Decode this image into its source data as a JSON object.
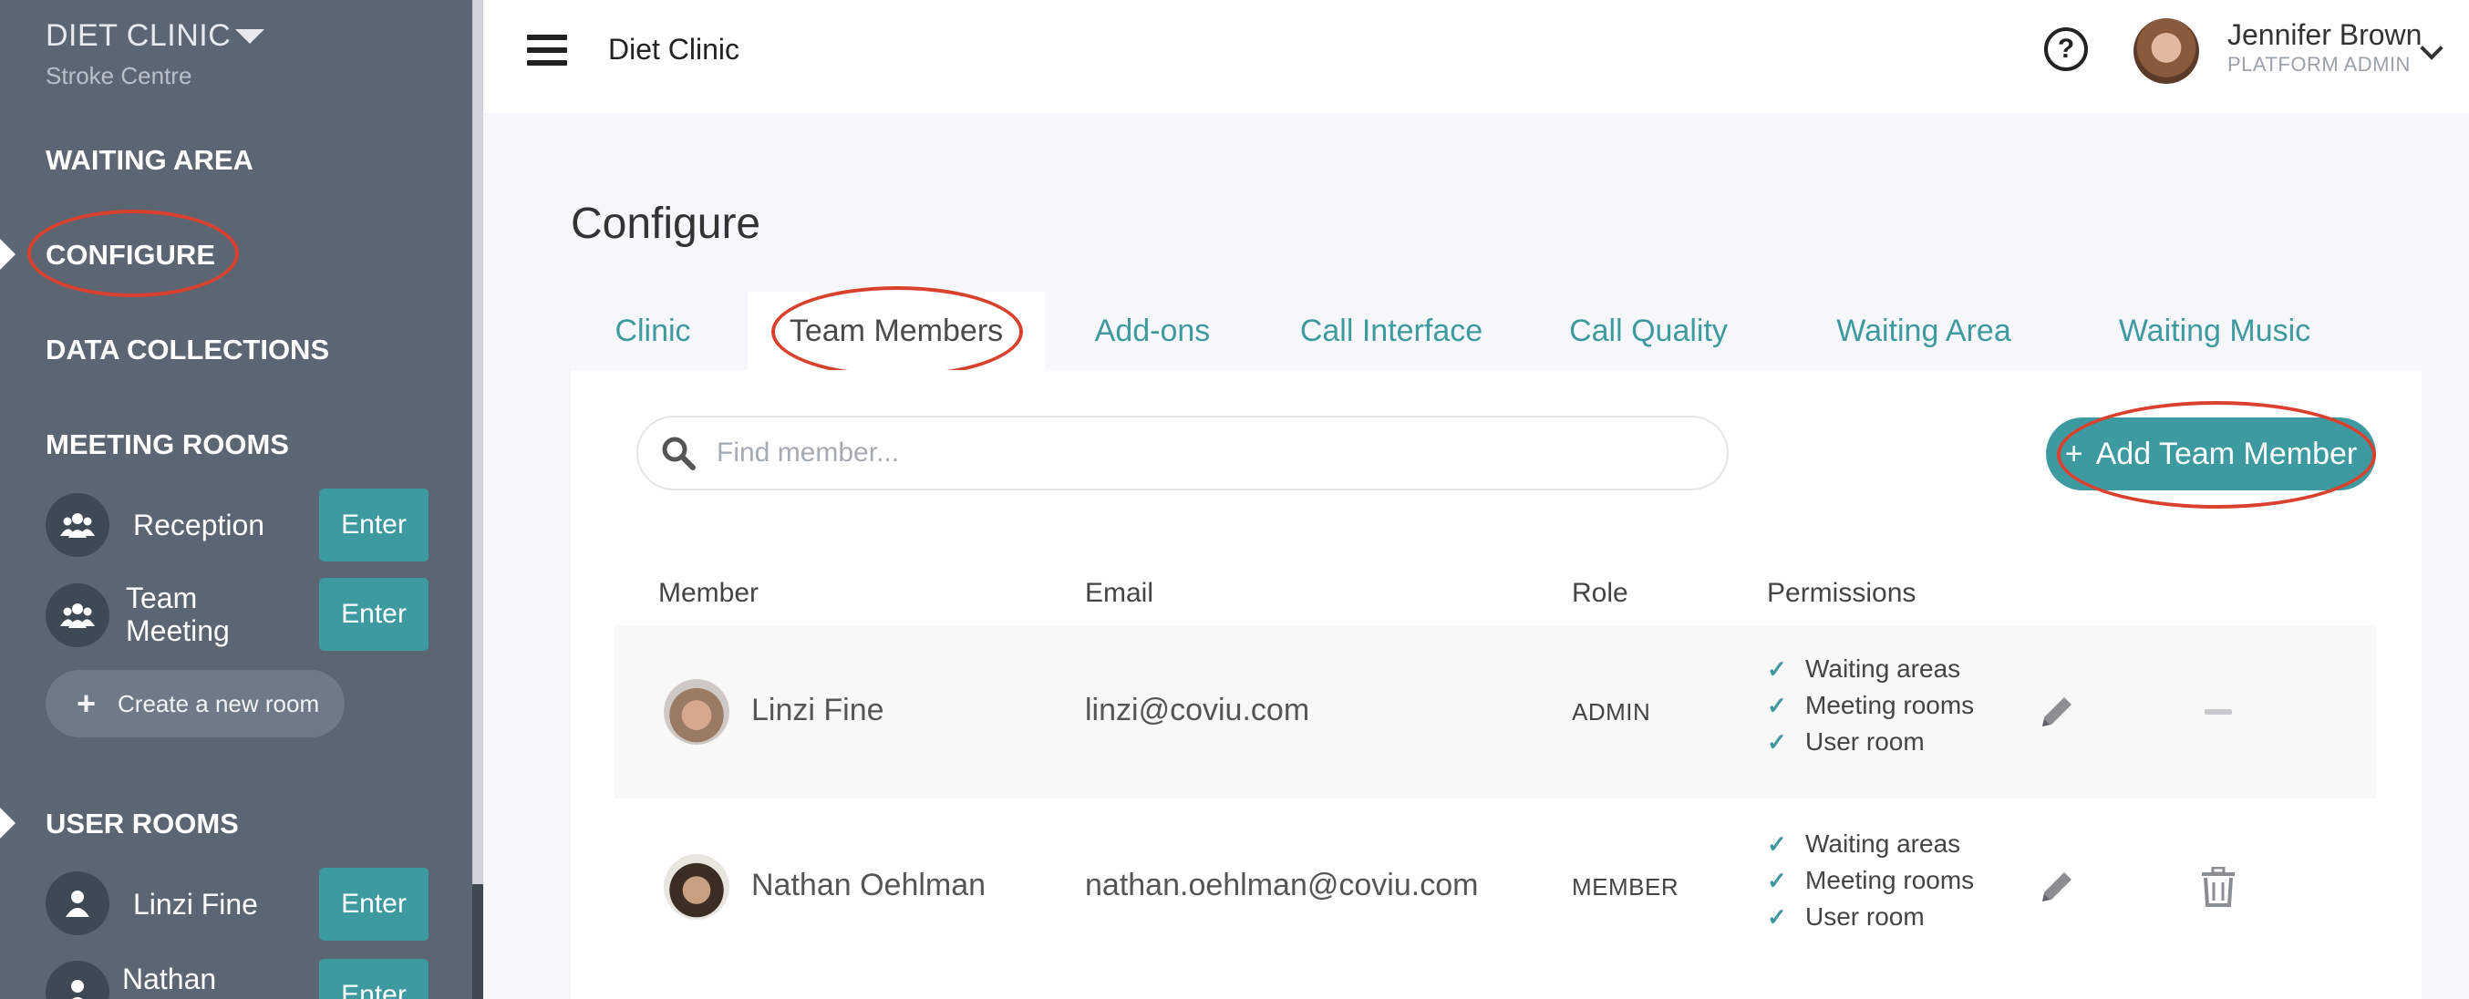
{
  "sidebar": {
    "clinic_name": "DIET CLINIC",
    "clinic_sub": "Stroke Centre",
    "nav": {
      "waiting_area": "WAITING AREA",
      "configure": "CONFIGURE",
      "data_collections": "DATA COLLECTIONS",
      "meeting_rooms": "MEETING ROOMS",
      "user_rooms": "USER ROOMS"
    },
    "meeting_rooms": [
      {
        "name": "Reception",
        "button": "Enter"
      },
      {
        "name": "Team Meeting",
        "button": "Enter"
      }
    ],
    "create_room": "Create a new room",
    "user_rooms": [
      {
        "name": "Linzi Fine",
        "button": "Enter"
      },
      {
        "name": "Nathan",
        "button": "Enter"
      }
    ]
  },
  "header": {
    "title": "Diet Clinic",
    "user_name": "Jennifer Brown",
    "user_role": "PLATFORM ADMIN"
  },
  "main": {
    "page_title": "Configure",
    "tabs": [
      "Clinic",
      "Team Members",
      "Add-ons",
      "Call Interface",
      "Call Quality",
      "Waiting Area",
      "Waiting Music"
    ],
    "active_tab": "Team Members",
    "search_placeholder": "Find member...",
    "add_button": "Add Team Member",
    "columns": [
      "Member",
      "Email",
      "Role",
      "Permissions"
    ],
    "members": [
      {
        "name": "Linzi Fine",
        "email": "linzi@coviu.com",
        "role": "ADMIN",
        "permissions": [
          "Waiting areas",
          "Meeting rooms",
          "User room"
        ]
      },
      {
        "name": "Nathan Oehlman",
        "email": "nathan.oehlman@coviu.com",
        "role": "MEMBER",
        "permissions": [
          "Waiting areas",
          "Meeting rooms",
          "User room"
        ]
      }
    ]
  },
  "colors": {
    "sidebar": "#5b6672",
    "accent": "#3e9aa1",
    "annotation": "#d9412e"
  }
}
